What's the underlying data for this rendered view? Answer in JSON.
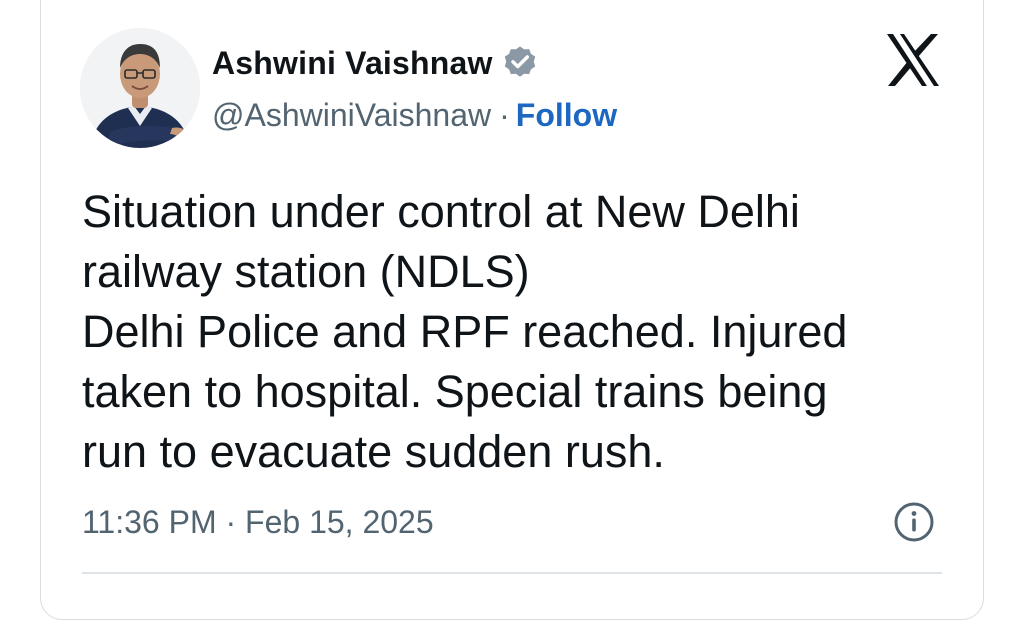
{
  "author": {
    "display_name": "Ashwini Vaishnaw",
    "handle": "@AshwiniVaishnaw",
    "separator": "·",
    "follow_label": "Follow",
    "verified_badge_icon": "verified-badge-icon",
    "avatar_icon": "profile-photo"
  },
  "platform": {
    "logo_icon": "x-logo-icon"
  },
  "tweet": {
    "lines": [
      "Situation under control at New Delhi",
      "railway station (NDLS)",
      "Delhi Police and RPF reached. Injured",
      "taken to hospital. Special trains being",
      "run to evacuate sudden rush."
    ],
    "time": "11:36 PM",
    "meta_separator": "·",
    "date": "Feb 15, 2025",
    "info_icon": "info-icon"
  },
  "colors": {
    "text_primary": "#0f1419",
    "text_secondary": "#536471",
    "follow_blue": "#1d67c2",
    "badge_gray": "#8b98a5",
    "border": "#d7dde2"
  }
}
